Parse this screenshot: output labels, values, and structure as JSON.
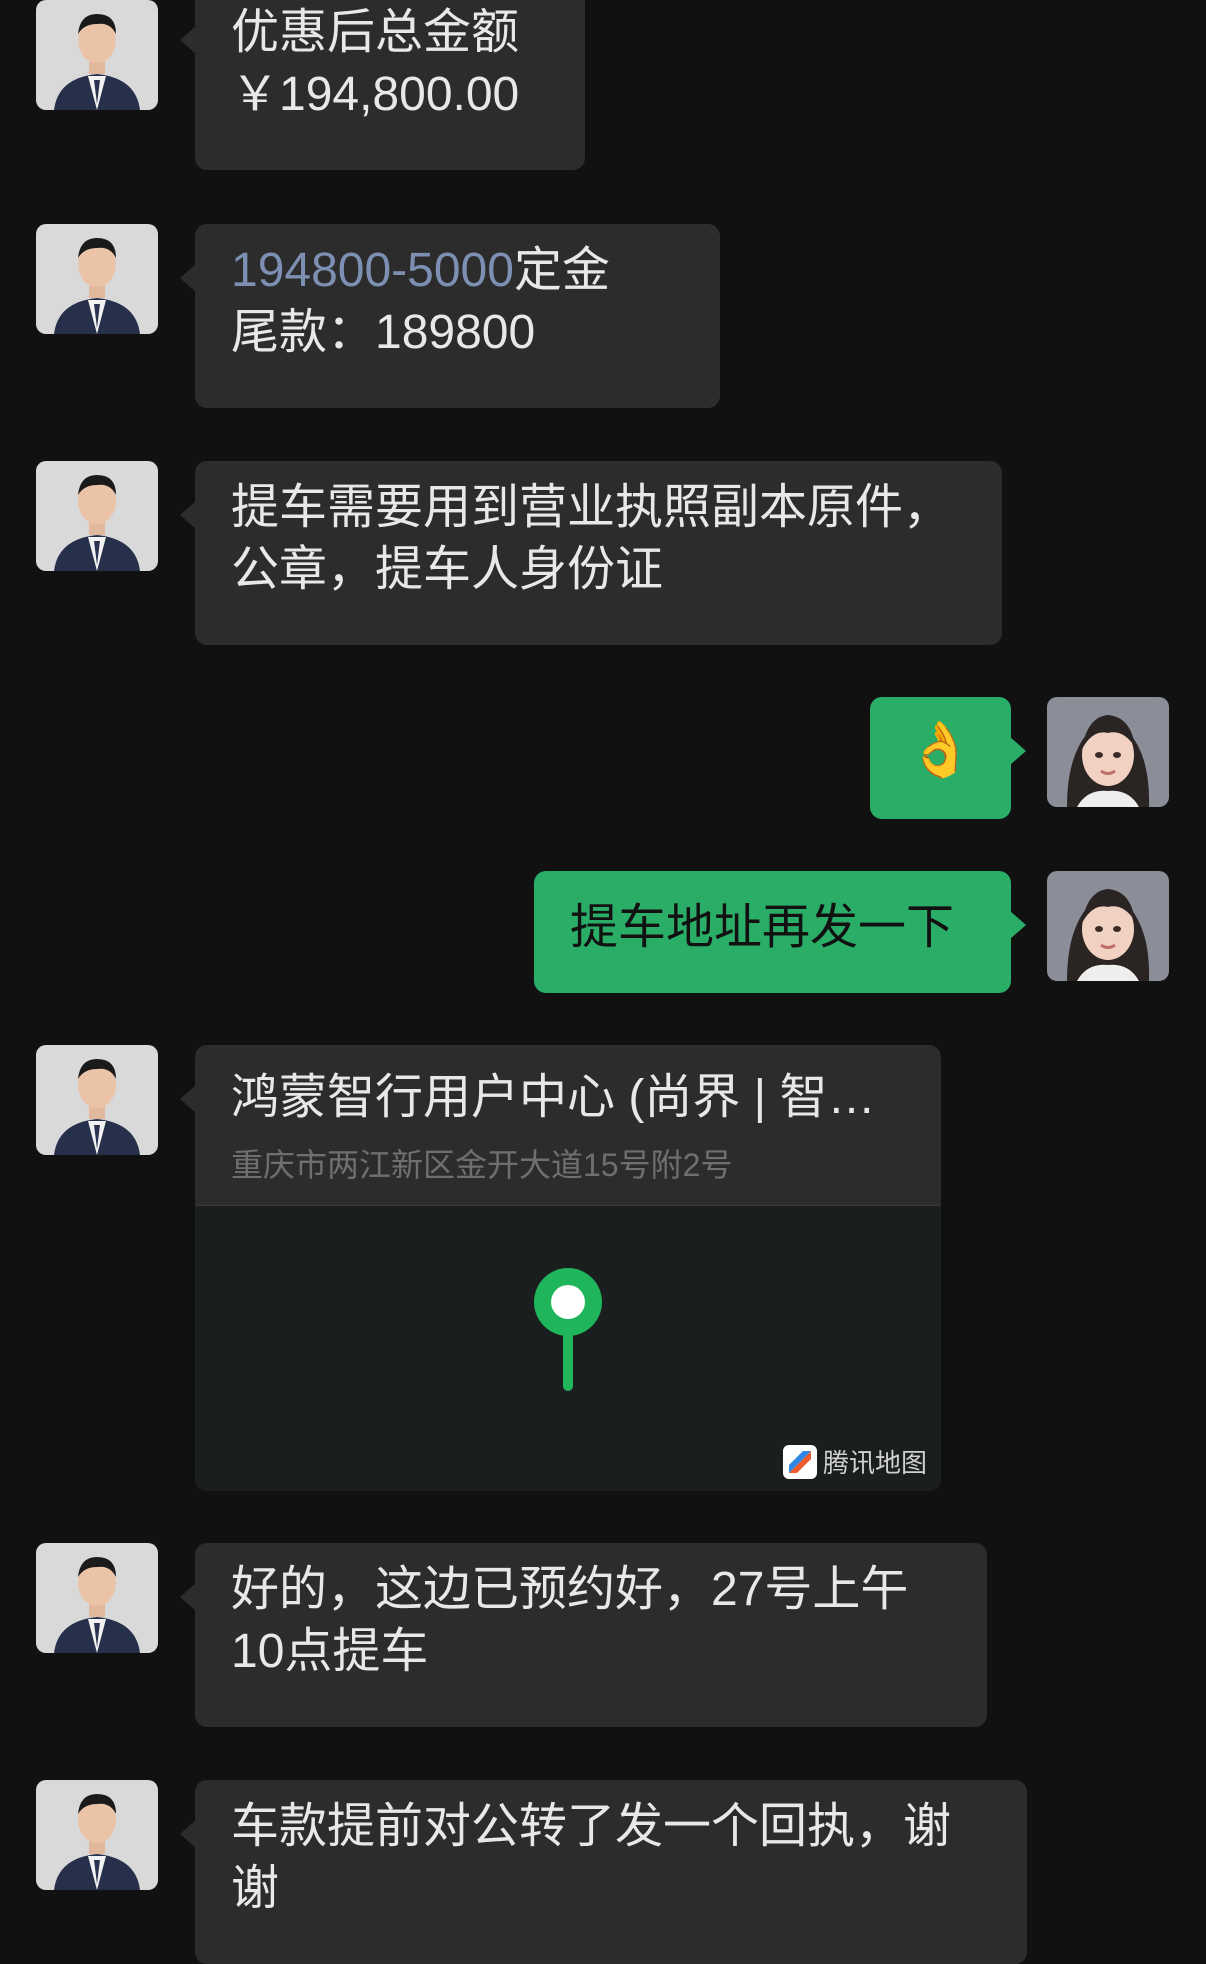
{
  "messages": [
    {
      "id": "m1",
      "lines": [
        "优惠后总金额",
        "￥194,800.00"
      ]
    },
    {
      "id": "m2",
      "link": "194800-5000",
      "after_link": "定金",
      "line2": "尾款：189800"
    },
    {
      "id": "m3",
      "lines": [
        "提车需要用到营业执照副本原件，",
        "公章，提车人身份证"
      ]
    },
    {
      "id": "m4",
      "emoji": "👌"
    },
    {
      "id": "m5",
      "text": "提车地址再发一下"
    },
    {
      "id": "m7",
      "lines": [
        "好的，这边已预约好，27号上午",
        "10点提车"
      ]
    },
    {
      "id": "m8",
      "lines": [
        "车款提前对公转了发一个回执，谢",
        "谢"
      ]
    }
  ],
  "location": {
    "title": "鸿蒙智行用户中心 (尚界 | 智…",
    "address": "重庆市两江新区金开大道15号附2号",
    "map_provider": "腾讯地图"
  },
  "colors": {
    "background": "#111111",
    "incoming": "#2c2c2c",
    "outgoing": "#2aae67",
    "pin": "#1fb65b"
  }
}
